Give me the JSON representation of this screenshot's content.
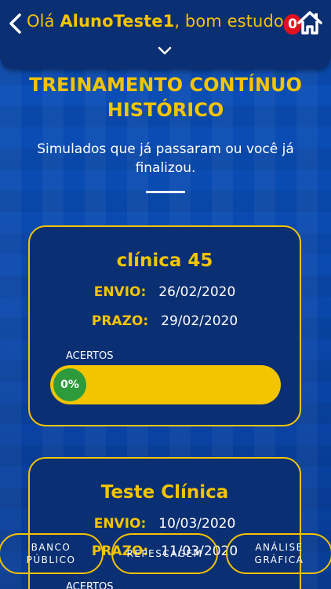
{
  "header": {
    "greeting_prefix": "Olá ",
    "username": "AlunoTeste1",
    "greeting_suffix": ", bom estudo.",
    "notification_count": "0",
    "accent_color": "#f3c400"
  },
  "page": {
    "title_line1": "TREINAMENTO CONTÍNUO",
    "title_line2": "HISTÓRICO",
    "subtitle": "Simulados que já passaram ou você já finalizou."
  },
  "cards": [
    {
      "title": "clínica 45",
      "envio_label": "ENVIO:",
      "envio_value": "26/02/2020",
      "prazo_label": "PRAZO:",
      "prazo_value": "29/02/2020",
      "acertos_label": "ACERTOS",
      "acertos_value": "0%"
    },
    {
      "title": "Teste Clínica",
      "envio_label": "ENVIO:",
      "envio_value": "10/03/2020",
      "prazo_label": "PRAZO:",
      "prazo_value": "11/03/2020",
      "acertos_label": "ACERTOS"
    }
  ],
  "bottom_nav": {
    "banco_line1": "BANCO",
    "banco_line2": "PÚBLICO",
    "repescagem": "REPESCAGEM",
    "analise_line1": "ANÁLISE",
    "analise_line2": "GRÁFICA"
  }
}
